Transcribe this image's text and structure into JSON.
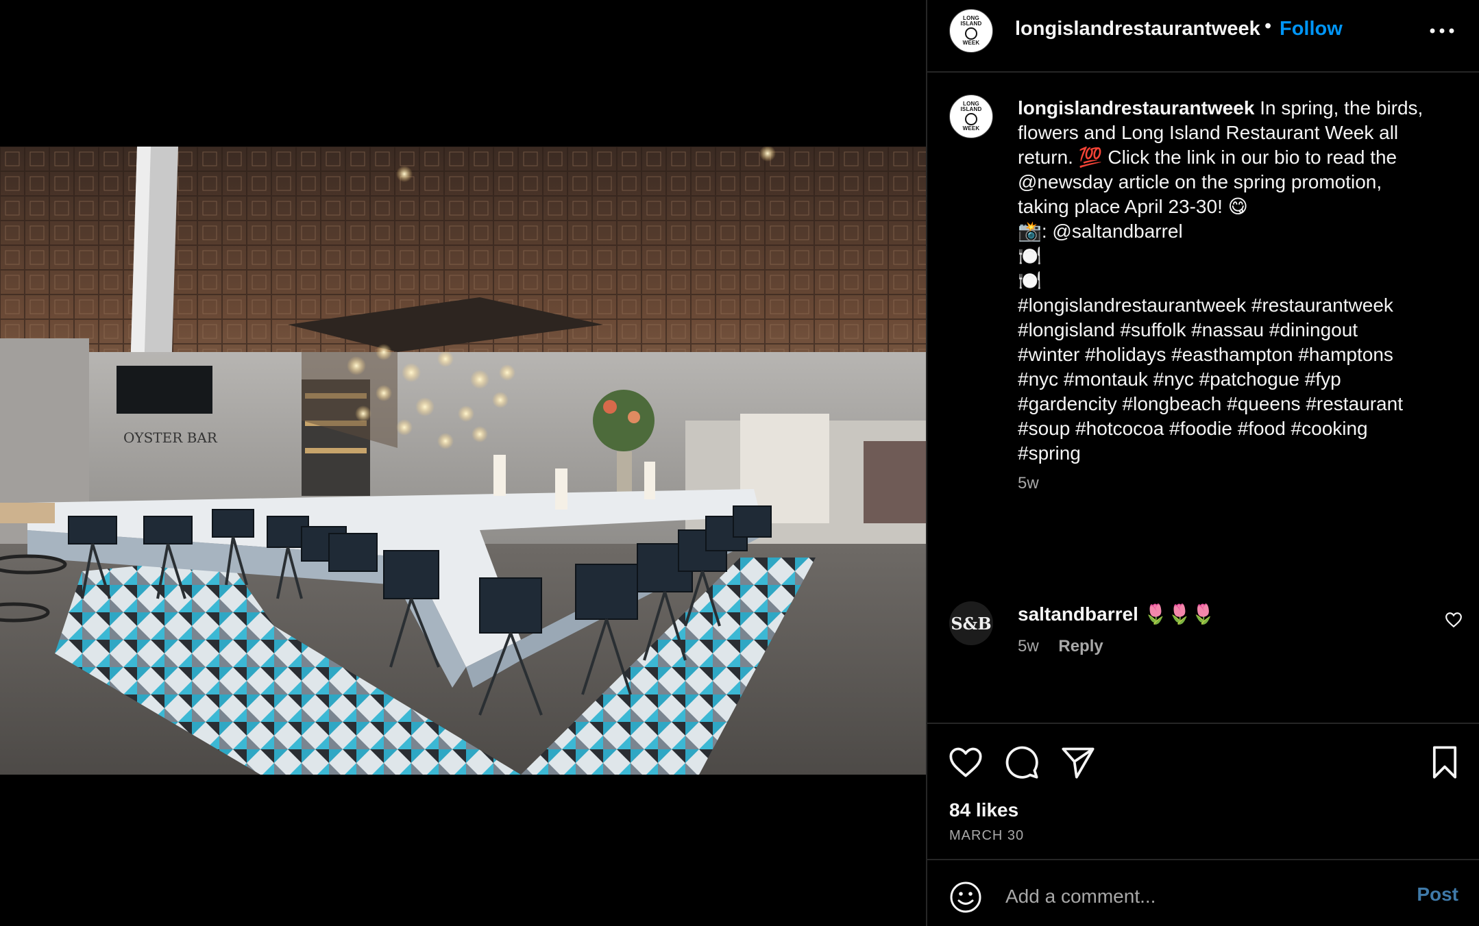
{
  "post": {
    "username": "longislandrestaurantweek",
    "follow_label": "Follow",
    "separator": "•",
    "avatar_text": [
      "LONG",
      "ISLAND",
      "WEEK"
    ],
    "photo_sign_text": "OYSTER BAR"
  },
  "caption": {
    "username": "longislandrestaurantweek",
    "lines": [
      " In spring, the birds,",
      "flowers and Long Island Restaurant Week all",
      "return. 💯 Click the link in our bio to read the",
      "@newsday article on the spring promotion,",
      "taking place April 23-30! 😋",
      "📸: @saltandbarrel",
      "🍽️",
      "🍽️",
      "#longislandrestaurantweek #restaurantweek",
      "#longisland #suffolk #nassau #diningout",
      "#winter #holidays #easthampton #hamptons",
      "#nyc #montauk #nyc #patchogue #fyp",
      "#gardencity #longbeach #queens #restaurant",
      "#soup #hotcocoa #foodie #food #cooking",
      "#spring"
    ],
    "time": "5w"
  },
  "comment": {
    "avatar_text": "S&B",
    "username": "saltandbarrel",
    "text": " 🌷🌷🌷",
    "time": "5w",
    "reply_label": "Reply"
  },
  "stats": {
    "likes": "84 likes",
    "date": "MARCH 30"
  },
  "comment_input": {
    "placeholder": "Add a comment...",
    "post_label": "Post"
  },
  "icons": {
    "like": "heart-icon",
    "comment": "comment-icon",
    "share": "send-icon",
    "save": "bookmark-icon",
    "more": "more-icon",
    "emoji": "emoji-icon"
  },
  "colors": {
    "background": "#000000",
    "follow": "#0095f6",
    "post": "#3f79a8",
    "muted": "#a8a8a8",
    "divider": "#262626"
  }
}
